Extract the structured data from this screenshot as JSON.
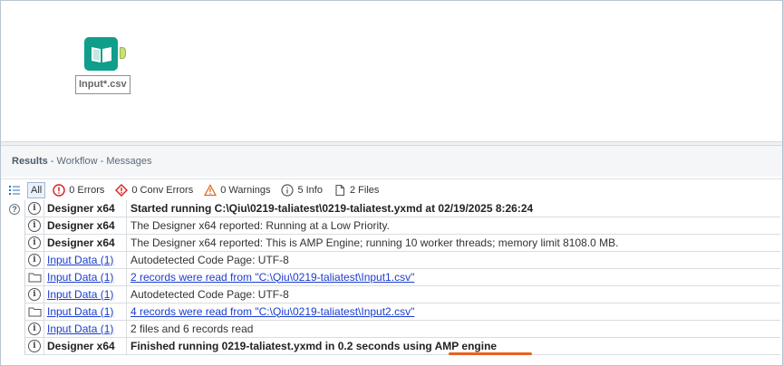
{
  "canvas": {
    "tool_label": "Input*.csv"
  },
  "results_header": {
    "title": "Results",
    "subtitle": " - Workflow - Messages"
  },
  "filters": {
    "all": "All",
    "errors": "0 Errors",
    "conv_errors": "0 Conv Errors",
    "warnings": "0 Warnings",
    "info": "5 Info",
    "files": "2 Files"
  },
  "messages": [
    {
      "icon": "info-icon",
      "tool": "Designer x64",
      "tool_style": "bold",
      "text": "Started running C:\\Qiu\\0219-taliatest\\0219-taliatest.yxmd at 02/19/2025 8:26:24",
      "text_style": "bold"
    },
    {
      "icon": "info-icon",
      "tool": "Designer x64",
      "tool_style": "bold",
      "text": "The Designer x64 reported: Running at a Low Priority.",
      "text_style": "normal"
    },
    {
      "icon": "info-icon",
      "tool": "Designer x64",
      "tool_style": "bold",
      "text": "The Designer x64 reported: This is AMP Engine; running 10 worker threads; memory limit 8108.0 MB.",
      "text_style": "normal"
    },
    {
      "icon": "info-icon",
      "tool": "Input Data (1)",
      "tool_style": "link",
      "text": "Autodetected Code Page: UTF-8",
      "text_style": "normal"
    },
    {
      "icon": "folder-icon",
      "tool": "Input Data (1)",
      "tool_style": "link",
      "text": "2 records were read from \"C:\\Qiu\\0219-taliatest\\Input1.csv\"",
      "text_style": "link"
    },
    {
      "icon": "info-icon",
      "tool": "Input Data (1)",
      "tool_style": "link",
      "text": "Autodetected Code Page: UTF-8",
      "text_style": "normal"
    },
    {
      "icon": "folder-icon",
      "tool": "Input Data (1)",
      "tool_style": "link",
      "text": "4 records were read from \"C:\\Qiu\\0219-taliatest\\Input2.csv\"",
      "text_style": "link"
    },
    {
      "icon": "info-icon",
      "tool": "Input Data (1)",
      "tool_style": "link",
      "text": "2 files and 6 records read",
      "text_style": "normal"
    },
    {
      "icon": "info-icon",
      "tool": "Designer x64",
      "tool_style": "bold",
      "text": "Finished running 0219-taliatest.yxmd in 0.2 seconds using AMP engine",
      "text_style": "bold"
    }
  ],
  "colors": {
    "tool_icon": "#0e9e8a",
    "highlight_underline": "#e8621c",
    "link": "#1a3cd0"
  }
}
